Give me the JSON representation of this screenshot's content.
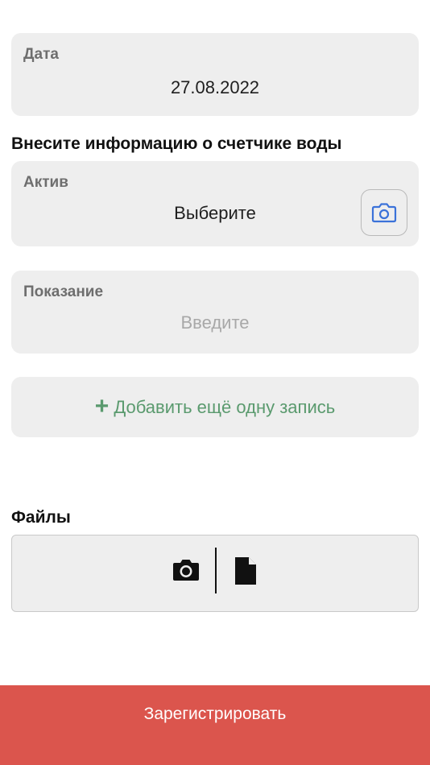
{
  "date_field": {
    "label": "Дата",
    "value": "27.08.2022"
  },
  "meter_section": {
    "title": "Внесите информацию о счетчике воды"
  },
  "asset_field": {
    "label": "Актив",
    "value": "Выберите",
    "scan_icon": "camera-icon"
  },
  "reading_field": {
    "label": "Показание",
    "placeholder": "Введите"
  },
  "add_record": {
    "icon": "plus-icon",
    "label": "Добавить ещё одну запись"
  },
  "files_section": {
    "title": "Файлы",
    "icons": [
      "camera-icon",
      "document-icon"
    ]
  },
  "register_button": {
    "label": "Зарегистрировать"
  },
  "colors": {
    "accent_green": "#5a9a6e",
    "scan_icon_blue": "#3b72d9",
    "register_red": "#db554d",
    "card_gray": "#eeeeee"
  }
}
